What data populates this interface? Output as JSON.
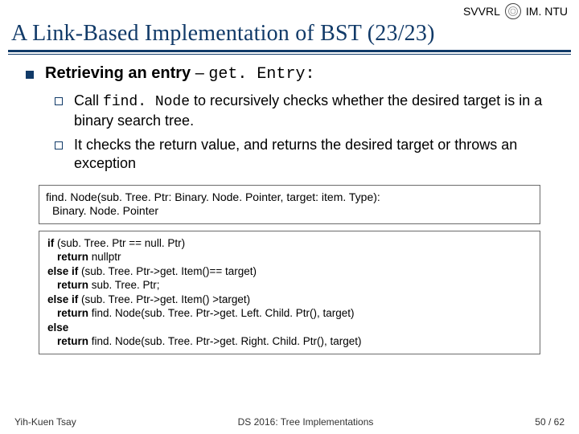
{
  "header": {
    "org": "SVVRL",
    "at": "@",
    "inst": "IM. NTU"
  },
  "title": "A Link-Based Implementation of BST (23/23)",
  "l1": {
    "pre": "Retrieving an entry",
    "dash": " – ",
    "func": "get. Entry:"
  },
  "b1": {
    "a": "Call ",
    "code": "find. Node",
    "b": " to recursively checks whether the desired target is in a binary search tree."
  },
  "b2": "It checks the return value, and returns the desired target or throws an exception",
  "sig": {
    "line1": "find. Node(sub. Tree. Ptr: Binary. Node. Pointer, target: item. Type):",
    "line2": "Binary. Node. Pointer"
  },
  "pseudo": {
    "l1a": "if",
    "l1b": " (sub. Tree. Ptr == null. Ptr)",
    "l2a": "return",
    "l2b": " nullptr",
    "l3a": "else if",
    "l3b": " (sub. Tree. Ptr->get. Item()== target)",
    "l4a": "return",
    "l4b": " sub. Tree. Ptr;",
    "l5a": "else if",
    "l5b": " (sub. Tree. Ptr->get. Item() >target)",
    "l6a": "return",
    "l6b": " find. Node(sub. Tree. Ptr->get. Left. Child. Ptr(), target)",
    "l7a": "else",
    "l8a": "return",
    "l8b": " find. Node(sub. Tree. Ptr->get. Right. Child. Ptr(), target)"
  },
  "footer": {
    "left": "Yih-Kuen Tsay",
    "center": "DS 2016: Tree Implementations",
    "right": "50 / 62"
  }
}
